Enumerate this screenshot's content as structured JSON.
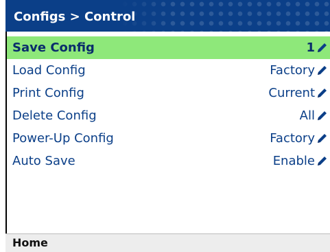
{
  "title": "Configs > Control",
  "menu": [
    {
      "label": "Save Config",
      "value": "1",
      "selected": true
    },
    {
      "label": "Load Config",
      "value": "Factory"
    },
    {
      "label": "Print Config",
      "value": "Current"
    },
    {
      "label": "Delete Config",
      "value": "All"
    },
    {
      "label": "Power-Up Config",
      "value": "Factory"
    },
    {
      "label": "Auto Save",
      "value": "Enable"
    }
  ],
  "footer": {
    "home_label": "Home"
  },
  "icons": {
    "edit": "pencil-icon"
  },
  "colors": {
    "title_bg": "#0b3f88",
    "selected_bg": "#8ee87a",
    "text": "#0b3f88"
  }
}
